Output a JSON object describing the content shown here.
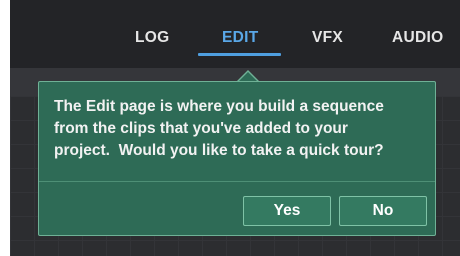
{
  "tabs": [
    {
      "label": "LOG",
      "active": false
    },
    {
      "label": "EDIT",
      "active": true
    },
    {
      "label": "VFX",
      "active": false
    },
    {
      "label": "AUDIO",
      "active": false
    }
  ],
  "popover": {
    "lines": [
      "The Edit page is where you build a sequence",
      "from the clips that you've added to your",
      "project.  Would you like to take a quick tour?"
    ],
    "yes_label": "Yes",
    "no_label": "No"
  },
  "colors": {
    "active_tab": "#5aa8e8",
    "popover_bg": "#2e6b56",
    "popover_border": "#6fb196",
    "button_bg": "#347a61"
  }
}
